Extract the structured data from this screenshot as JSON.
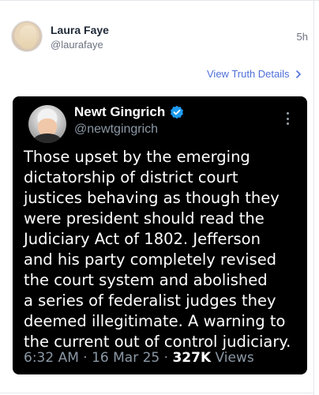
{
  "post": {
    "author_name": "Laura Faye",
    "author_handle": "@laurafaye",
    "time_ago": "5h",
    "details_link": "View Truth Details"
  },
  "embed": {
    "name": "Newt Gingrich",
    "handle": "@newtgingrich",
    "text_lines": [
      "Those upset by the emerging",
      "dictatorship of district court",
      "justices behaving as though they",
      "were president should read the",
      "Judiciary Act of 1802. Jefferson",
      "and his party completely revised",
      "the court system and abolished",
      "a series of federalist judges they",
      "deemed illegitimate. A warning to",
      "the current out of control judiciary."
    ],
    "timestamp": "6:32 AM · 16 Mar 25 · ",
    "views_count": "327K",
    "views_label": " Views"
  },
  "colors": {
    "link": "#4f6fd8",
    "embed_bg": "#000000",
    "verified": "#1d9bf0"
  },
  "icons": {
    "details_chevron": "chevron-right-icon",
    "verified": "verified-badge-icon",
    "more": "more-vertical-icon"
  }
}
